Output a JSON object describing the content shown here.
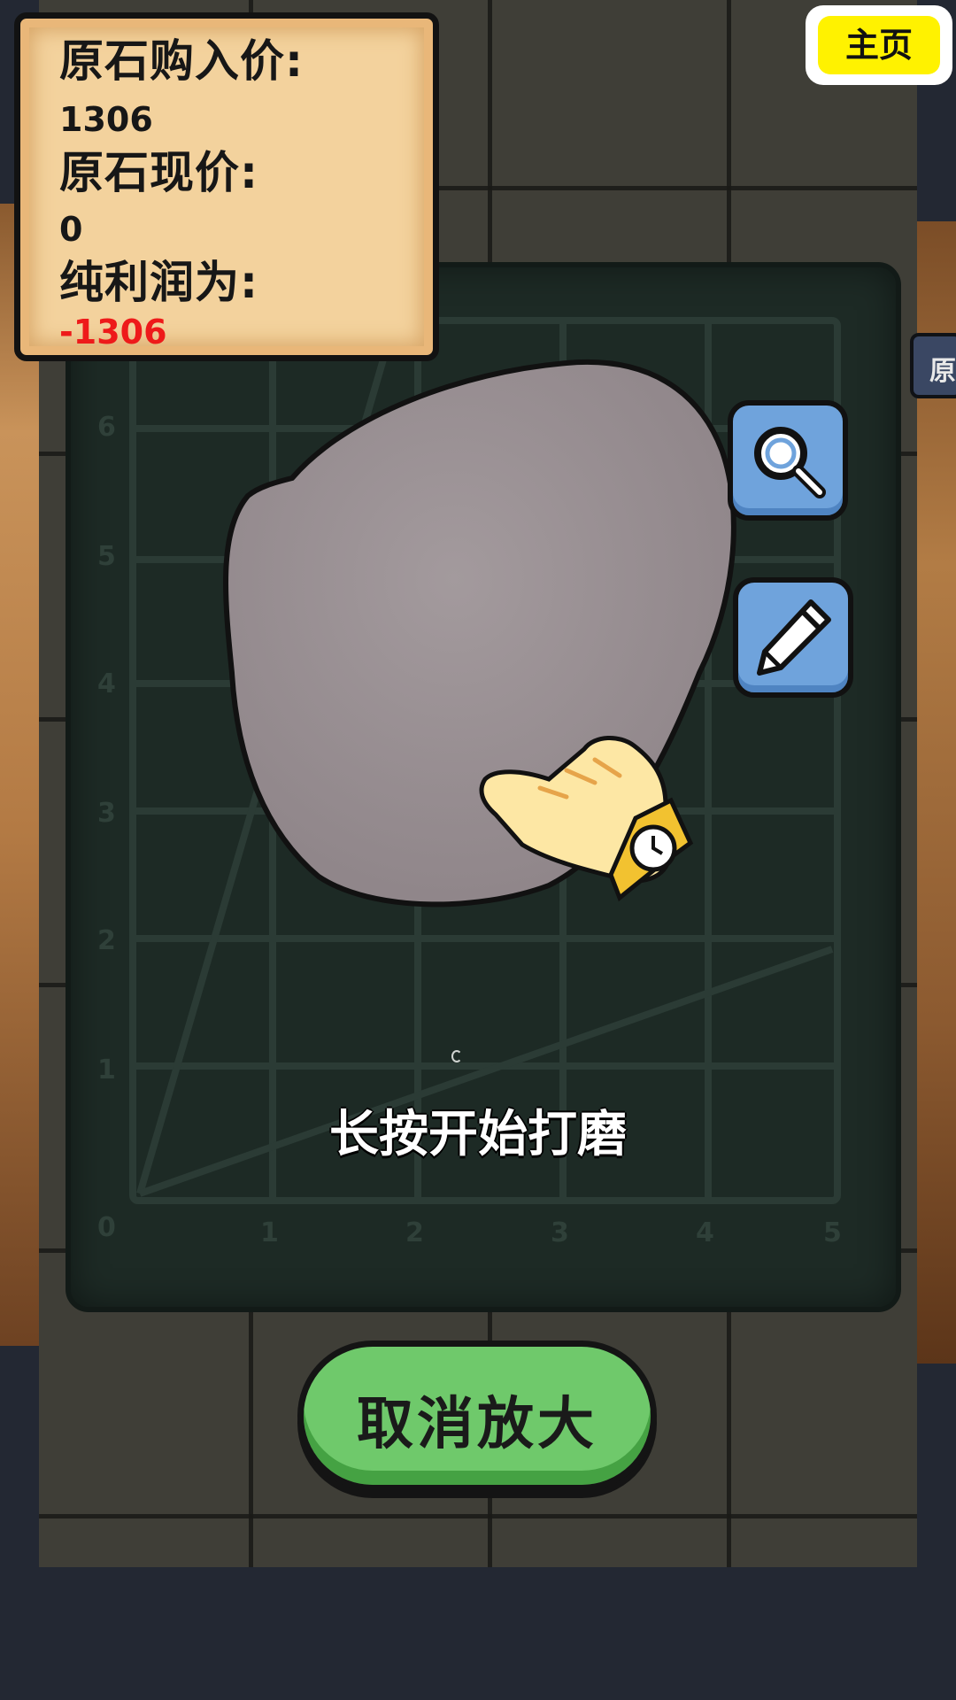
{
  "price_panel": {
    "purchase_label": "原石购入价:",
    "purchase_value": "1306",
    "current_label": "原石现价:",
    "current_value": "0",
    "profit_label": "纯利润为:",
    "profit_value": "-1306"
  },
  "home_button": {
    "label": "主页"
  },
  "side_tab": {
    "label": "原"
  },
  "board": {
    "y_ticks": [
      "0",
      "1",
      "2",
      "3",
      "4",
      "5",
      "6"
    ],
    "x_ticks": [
      "1",
      "2",
      "3",
      "4",
      "5"
    ]
  },
  "tools": {
    "zoom_icon": "magnifier-icon",
    "draw_icon": "pencil-icon"
  },
  "hint": "长按开始打磨",
  "cancel_button": {
    "label": "取消放大"
  },
  "colors": {
    "profit_negative": "#ee1a1a",
    "home_button": "#fff200",
    "cancel_button": "#6fc96b",
    "tool_button": "#6fa3dc"
  }
}
